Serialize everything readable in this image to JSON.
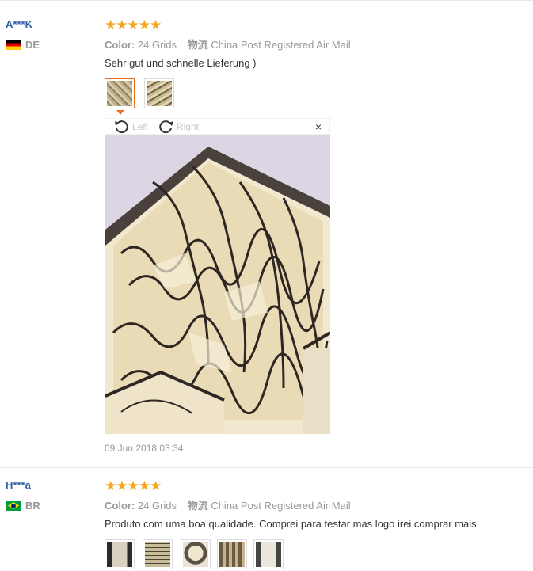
{
  "reviews": [
    {
      "user": "A***K",
      "country": "DE",
      "rating": "★★★★★",
      "color_label": "Color:",
      "color_value": "24 Grids",
      "shipping_label": "物流",
      "shipping_value": "China Post Registered Air Mail",
      "text": "Sehr gut und schnelle Lieferung )",
      "viewer": {
        "left_label": "Left",
        "right_label": "Right",
        "close": "×"
      },
      "date": "09 Jun 2018 03:34"
    },
    {
      "user": "H***a",
      "country": "BR",
      "rating": "★★★★★",
      "color_label": "Color:",
      "color_value": "24 Grids",
      "shipping_label": "物流",
      "shipping_value": "China Post Registered Air Mail",
      "text": "Produto com uma boa qualidade. Comprei para testar mas logo irei comprar mais."
    }
  ],
  "icons": [
    "rotate-left-icon",
    "rotate-right-icon",
    "close-icon",
    "star-icon",
    "flag-de-icon",
    "flag-br-icon"
  ],
  "colors": {
    "username": "#2f5fa6",
    "stars": "#f5a623",
    "active_thumb": "#e96d1b",
    "muted": "#999999"
  }
}
